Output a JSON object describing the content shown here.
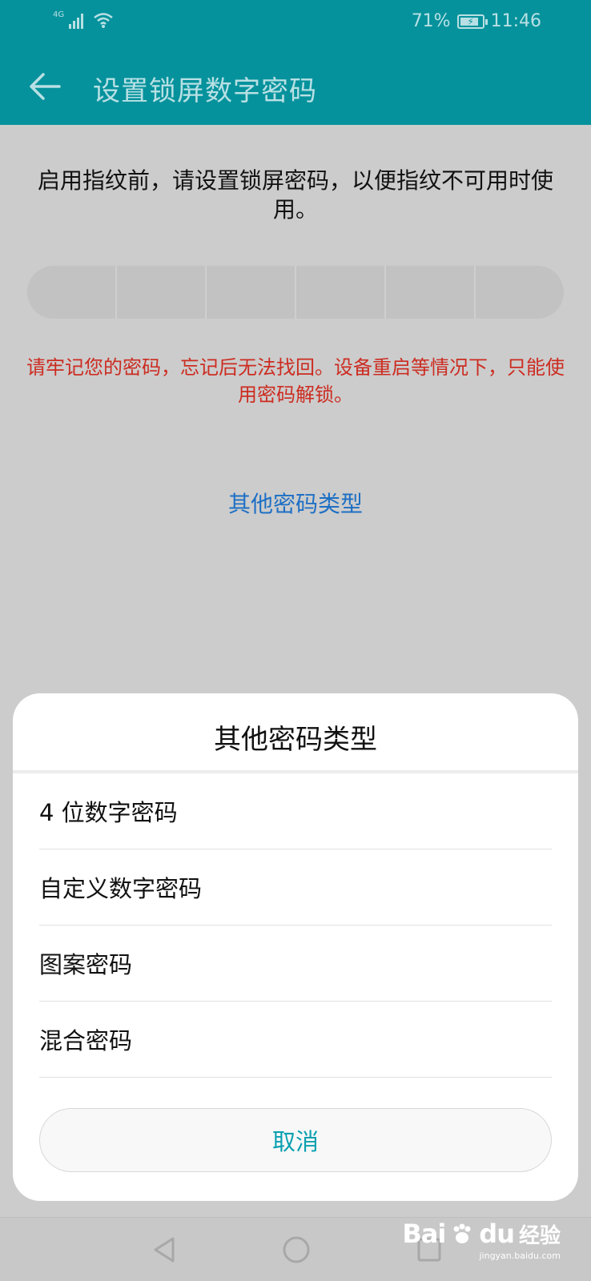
{
  "status_bar": {
    "network": "4G",
    "battery_percent": "71%",
    "time": "11:46"
  },
  "app_bar": {
    "title": "设置锁屏数字密码"
  },
  "content": {
    "intro": "启用指纹前，请设置锁屏密码，以便指纹不可用时使用。",
    "warning": "请牢记您的密码，忘记后无法找回。设备重启等情况下，只能使用密码解锁。",
    "other_types_link": "其他密码类型"
  },
  "sheet": {
    "title": "其他密码类型",
    "options": [
      "4 位数字密码",
      "自定义数字密码",
      "图案密码",
      "混合密码"
    ],
    "cancel": "取消"
  },
  "watermark": {
    "logo": "Bai",
    "logo2": "du",
    "text": "经验",
    "sub": "jingyan.baidu.com"
  },
  "colors": {
    "app_bar": "#05929c",
    "warning": "#cc2c21",
    "link": "#1e6fc4",
    "cancel": "#0aa0b0"
  }
}
